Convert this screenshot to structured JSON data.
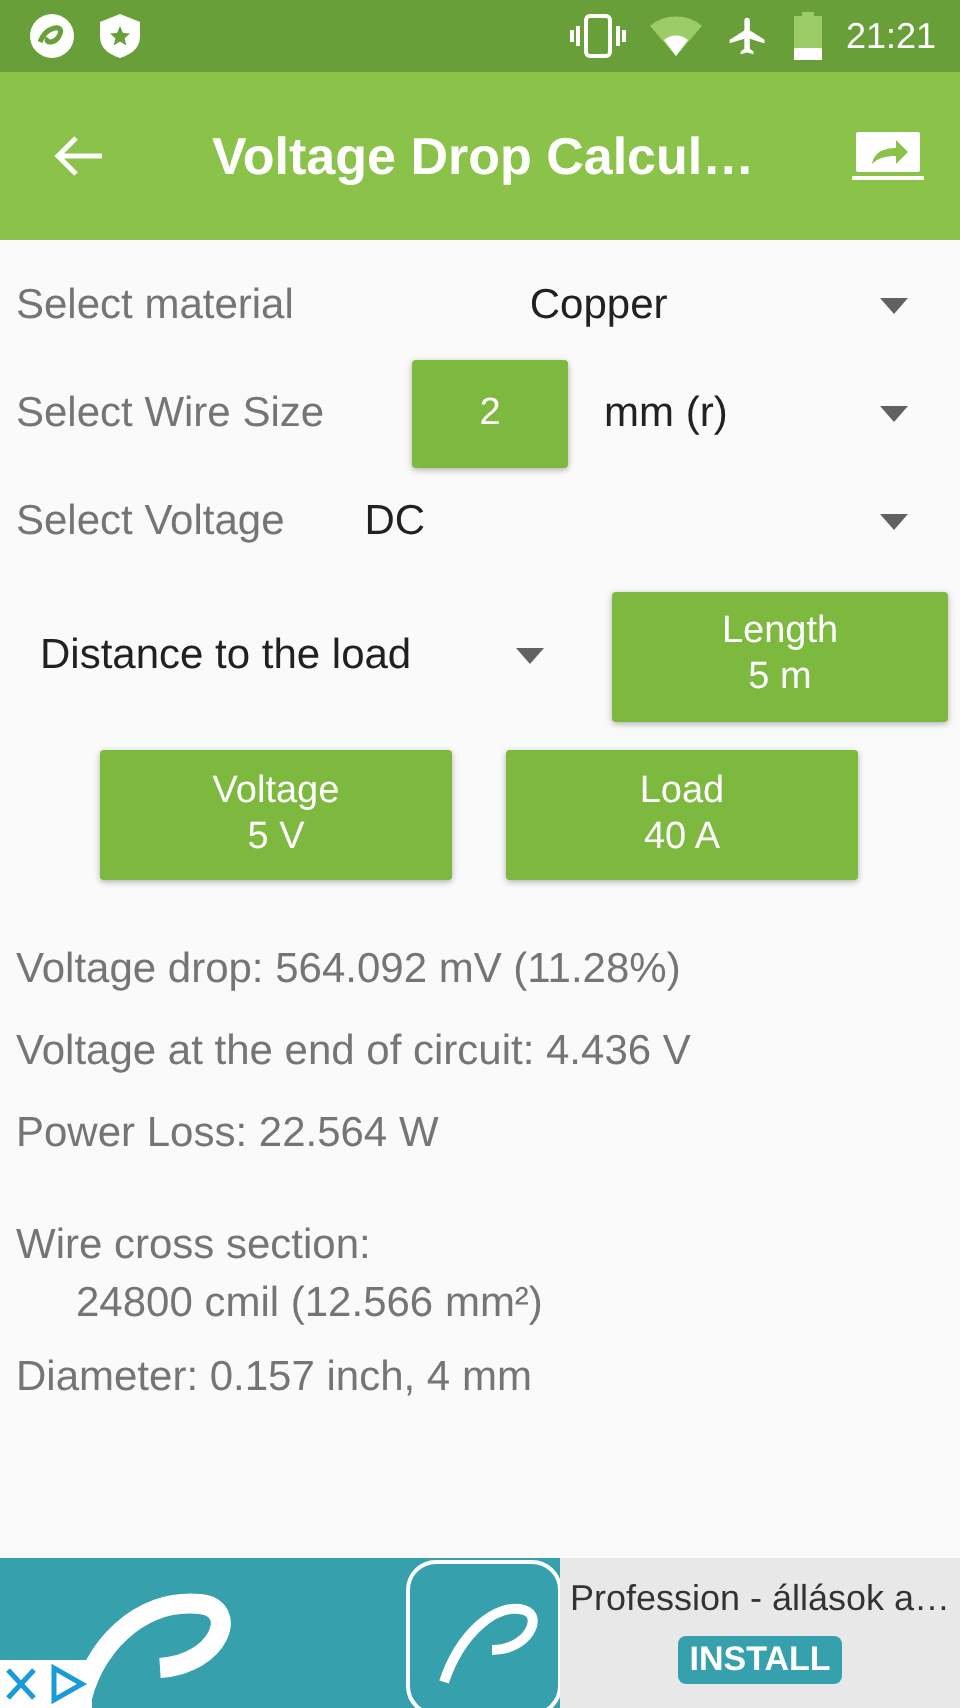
{
  "status_bar": {
    "time": "21:21"
  },
  "app_bar": {
    "title": "Voltage Drop Calcul…"
  },
  "selectors": [
    {
      "kind": "dropdown",
      "label": "Select material",
      "value": "Copper"
    },
    {
      "kind": "button-dropdown",
      "label": "Select Wire Size",
      "button": "2",
      "value": "mm (r)"
    },
    {
      "kind": "dropdown",
      "label": "Select Voltage",
      "value": "DC"
    }
  ],
  "distance": {
    "value": "Distance to the load",
    "button": {
      "label": "Length",
      "value": "5 m"
    }
  },
  "buttons": [
    {
      "label": "Voltage",
      "value": "5 V"
    },
    {
      "label": "Load",
      "value": "40 A"
    }
  ],
  "results": [
    {
      "kind": "line",
      "text": "Voltage drop: 564.092 mV (11.28%)"
    },
    {
      "kind": "line",
      "text": "Voltage at the end of circuit: 4.436 V"
    },
    {
      "kind": "line",
      "text": "Power Loss: 22.564 W"
    },
    {
      "kind": "heading",
      "text": "Wire cross section:"
    },
    {
      "kind": "indented",
      "text": "24800 cmil (12.566 mm²)"
    },
    {
      "kind": "line",
      "text": "Diameter: 0.157 inch, 4 mm"
    }
  ],
  "ad": {
    "title": "Profession - állások a…",
    "button": "INSTALL"
  }
}
